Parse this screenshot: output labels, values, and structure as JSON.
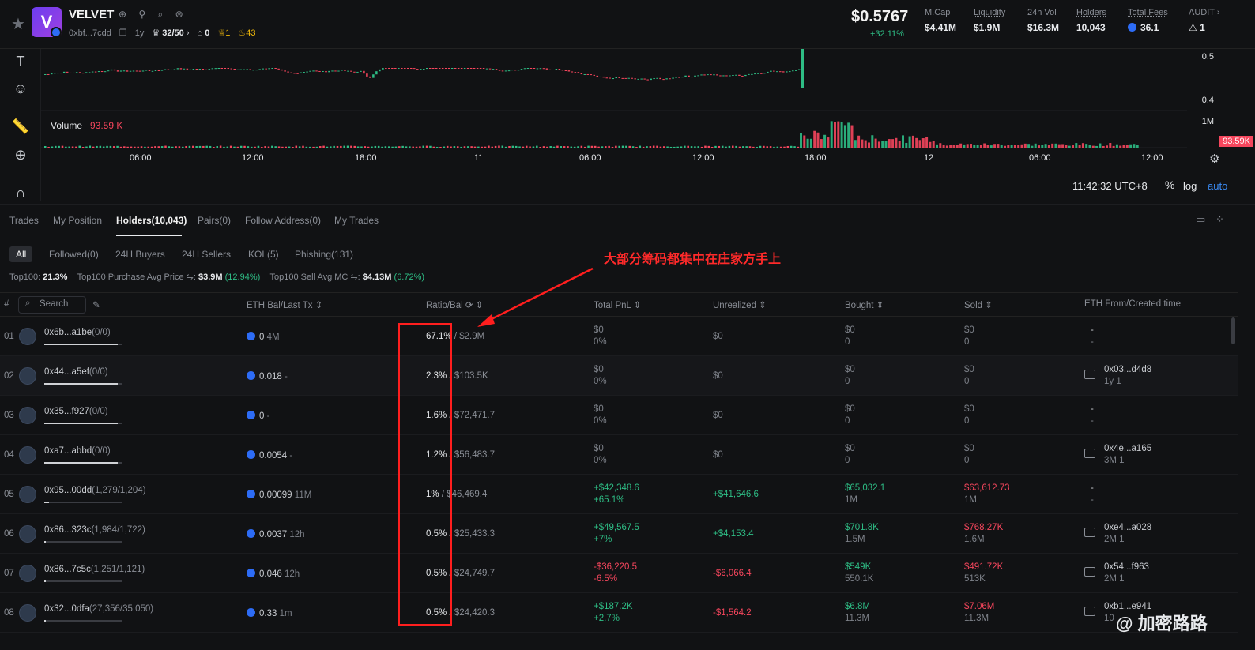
{
  "header": {
    "token_name": "VELVET",
    "address": "0xbf...7cdd",
    "age": "1y",
    "holders_ratio": "32/50",
    "c1": "0",
    "c2": "1",
    "c3": "43",
    "price": "$0.5767",
    "price_change": "+32.11%",
    "stats": [
      {
        "label": "M.Cap",
        "value": "$4.41M"
      },
      {
        "label": "Liquidity",
        "value": "$1.9M"
      },
      {
        "label": "24h Vol",
        "value": "$16.3M"
      },
      {
        "label": "Holders",
        "value": "10,043"
      },
      {
        "label": "Total Fees",
        "value": "36.1"
      },
      {
        "label": "AUDIT",
        "value": "1"
      }
    ]
  },
  "chart": {
    "price_axis": [
      "0.5",
      "0.4"
    ],
    "vol_axis": "1M",
    "vol_label": "Volume",
    "vol_value": "93.59 K",
    "vol_badge": "93.59K",
    "x_ticks": [
      "06:00",
      "12:00",
      "18:00",
      "11",
      "06:00",
      "12:00",
      "18:00",
      "12",
      "06:00",
      "12:00"
    ],
    "time": "11:42:32 UTC+8",
    "pct": "%",
    "log": "log",
    "auto": "auto"
  },
  "tabs": [
    "Trades",
    "My Position",
    "Holders(10,043)",
    "Pairs(0)",
    "Follow Address(0)",
    "My Trades"
  ],
  "filters": [
    "All",
    "Followed(0)",
    "24H Buyers",
    "24H Sellers",
    "KOL(5)",
    "Phishing(131)"
  ],
  "summary": {
    "top100_label": "Top100:",
    "top100": "21.3%",
    "buy_label": "Top100 Purchase Avg Price",
    "buy": "$3.9M",
    "buy_pct": "(12.94%)",
    "sell_label": "Top100 Sell Avg MC",
    "sell": "$4.13M",
    "sell_pct": "(6.72%)"
  },
  "annotation": "大部分筹码都集中在庄家方手上",
  "columns": {
    "rank": "#",
    "search": "Search",
    "eth": "ETH Bal/Last Tx",
    "ratio": "Ratio/Bal",
    "pnl": "Total PnL",
    "unrealized": "Unrealized",
    "bought": "Bought",
    "sold": "Sold",
    "from": "ETH From/Created time"
  },
  "rows": [
    {
      "rank": "01",
      "addr": "0x6b...a1be",
      "cnt": "(0/0)",
      "bar": 0.95,
      "eth": "0",
      "last": "4M",
      "ratio": "67.1%",
      "bal": "$2.9M",
      "pnl1": "$0",
      "pnl2": "0%",
      "pnl_cls": "dim",
      "unr": "$0",
      "unr_cls": "dim",
      "b1": "$0",
      "b2": "0",
      "s1": "$0",
      "s2": "0",
      "f1": "-",
      "f2": "-",
      "wal": false
    },
    {
      "rank": "02",
      "addr": "0x44...a5ef",
      "cnt": "(0/0)",
      "bar": 0.95,
      "eth": "0.018",
      "last": "-",
      "ratio": "2.3%",
      "bal": "$103.5K",
      "pnl1": "$0",
      "pnl2": "0%",
      "pnl_cls": "dim",
      "unr": "$0",
      "unr_cls": "dim",
      "b1": "$0",
      "b2": "0",
      "s1": "$0",
      "s2": "0",
      "f1": "0x03...d4d8",
      "f2": "1y  1",
      "wal": true
    },
    {
      "rank": "03",
      "addr": "0x35...f927",
      "cnt": "(0/0)",
      "bar": 0.95,
      "eth": "0",
      "last": "-",
      "ratio": "1.6%",
      "bal": "$72,471.7",
      "pnl1": "$0",
      "pnl2": "0%",
      "pnl_cls": "dim",
      "unr": "$0",
      "unr_cls": "dim",
      "b1": "$0",
      "b2": "0",
      "s1": "$0",
      "s2": "0",
      "f1": "-",
      "f2": "-",
      "wal": false
    },
    {
      "rank": "04",
      "addr": "0xa7...abbd",
      "cnt": "(0/0)",
      "bar": 0.95,
      "eth": "0.0054",
      "last": "-",
      "ratio": "1.2%",
      "bal": "$56,483.7",
      "pnl1": "$0",
      "pnl2": "0%",
      "pnl_cls": "dim",
      "unr": "$0",
      "unr_cls": "dim",
      "b1": "$0",
      "b2": "0",
      "s1": "$0",
      "s2": "0",
      "f1": "0x4e...a165",
      "f2": "3M  1",
      "wal": true
    },
    {
      "rank": "05",
      "addr": "0x95...00dd",
      "cnt": "(1,279/1,204)",
      "bar": 0.06,
      "eth": "0.00099",
      "last": "11M",
      "ratio": "1%",
      "bal": "$46,469.4",
      "pnl1": "+$42,348.6",
      "pnl2": "+65.1%",
      "pnl_cls": "g",
      "unr": "+$41,646.6",
      "unr_cls": "g",
      "b1": "$65,032.1",
      "b2": "1M",
      "s1": "$63,612.73",
      "s2": "1M",
      "f1": "-",
      "f2": "-",
      "wal": false
    },
    {
      "rank": "06",
      "addr": "0x86...323c",
      "cnt": "(1,984/1,722)",
      "bar": 0.02,
      "eth": "0.0037",
      "last": "12h",
      "ratio": "0.5%",
      "bal": "$25,433.3",
      "pnl1": "+$49,567.5",
      "pnl2": "+7%",
      "pnl_cls": "g",
      "unr": "+$4,153.4",
      "unr_cls": "g",
      "b1": "$701.8K",
      "b2": "1.5M",
      "s1": "$768.27K",
      "s2": "1.6M",
      "f1": "0xe4...a028",
      "f2": "2M  1",
      "wal": true
    },
    {
      "rank": "07",
      "addr": "0x86...7c5c",
      "cnt": "(1,251/1,121)",
      "bar": 0.02,
      "eth": "0.046",
      "last": "12h",
      "ratio": "0.5%",
      "bal": "$24,749.7",
      "pnl1": "-$36,220.5",
      "pnl2": "-6.5%",
      "pnl_cls": "r",
      "unr": "-$6,066.4",
      "unr_cls": "r",
      "b1": "$549K",
      "b2": "550.1K",
      "s1": "$491.72K",
      "s2": "513K",
      "f1": "0x54...f963",
      "f2": "2M  1",
      "wal": true
    },
    {
      "rank": "08",
      "addr": "0x32...0dfa",
      "cnt": "(27,356/35,050)",
      "bar": 0.02,
      "eth": "0.33",
      "last": "1m",
      "ratio": "0.5%",
      "bal": "$24,420.3",
      "pnl1": "+$187.2K",
      "pnl2": "+2.7%",
      "pnl_cls": "g",
      "unr": "-$1,564.2",
      "unr_cls": "r",
      "b1": "$6.8M",
      "b2": "11.3M",
      "s1": "$7.06M",
      "s2": "11.3M",
      "f1": "0xb1...e941",
      "f2": "10",
      "wal": true
    }
  ],
  "watermark": "@ 加密路路",
  "colors": {
    "up": "#2ebd85",
    "down": "#f6465d",
    "accent": "#3b8cf6",
    "annotation": "#ff2a2a"
  }
}
